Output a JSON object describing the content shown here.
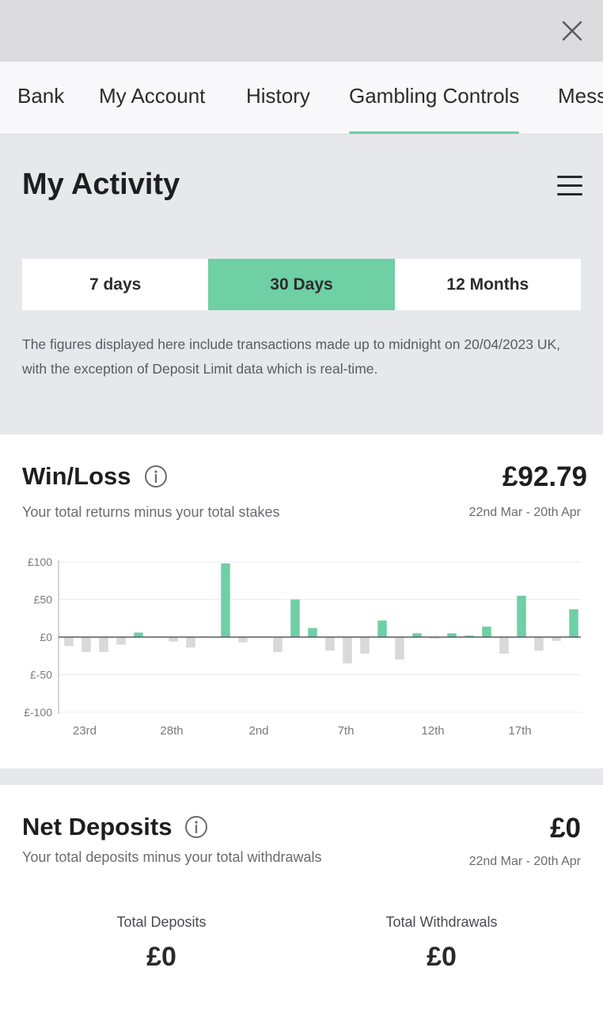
{
  "header": {
    "tabs": [
      {
        "label": "Bank"
      },
      {
        "label": "My Account"
      },
      {
        "label": "History"
      },
      {
        "label": "Gambling Controls"
      },
      {
        "label": "Mess"
      }
    ],
    "active_tab": "Gambling Controls",
    "close_icon": "close-icon"
  },
  "page": {
    "title": "My Activity",
    "menu_icon": "hamburger-menu-icon"
  },
  "period_selector": {
    "options": [
      {
        "label": "7 days"
      },
      {
        "label": "30 Days"
      },
      {
        "label": "12 Months"
      }
    ],
    "selected": "30 Days"
  },
  "disclaimer": "The figures displayed here include transactions made up to midnight on 20/04/2023 UK, with the exception of Deposit Limit data which is real-time.",
  "win_loss": {
    "title": "Win/Loss",
    "amount": "£92.79",
    "subtitle": "Your total returns minus your total stakes",
    "date_range": "22nd Mar - 20th Apr"
  },
  "net_deposits": {
    "title": "Net Deposits",
    "amount": "£0",
    "subtitle": "Your total deposits minus your total withdrawals",
    "date_range": "22nd Mar - 20th Apr",
    "total_deposits_label": "Total Deposits",
    "total_deposits_value": "£0",
    "total_withdrawals_label": "Total Withdrawals",
    "total_withdrawals_value": "£0"
  },
  "colors": {
    "accent": "#6fcfa5",
    "loss_bar": "#d9d9dc",
    "text_dark": "#1e1e20"
  },
  "chart_data": {
    "type": "bar",
    "ylim": [
      -100,
      100
    ],
    "yticks": [
      "£100",
      "£50",
      "£0",
      "£-50",
      "£-100"
    ],
    "ytick_values": [
      100,
      50,
      0,
      -50,
      -100
    ],
    "xtick_labels": [
      "23rd",
      "28th",
      "2nd",
      "7th",
      "12th",
      "17th"
    ],
    "xtick_day_index": [
      1,
      6,
      11,
      16,
      21,
      26
    ],
    "categories": [
      "22 Mar",
      "23 Mar",
      "24 Mar",
      "25 Mar",
      "26 Mar",
      "27 Mar",
      "28 Mar",
      "29 Mar",
      "30 Mar",
      "31 Mar",
      "1 Apr",
      "2 Apr",
      "3 Apr",
      "4 Apr",
      "5 Apr",
      "6 Apr",
      "7 Apr",
      "8 Apr",
      "9 Apr",
      "10 Apr",
      "11 Apr",
      "12 Apr",
      "13 Apr",
      "14 Apr",
      "15 Apr",
      "16 Apr",
      "17 Apr",
      "18 Apr",
      "19 Apr",
      "20 Apr"
    ],
    "values": [
      -12,
      -20,
      -20,
      -10,
      6,
      0,
      -6,
      -14,
      0,
      98,
      -7,
      0,
      -20,
      50,
      12,
      -18,
      -35,
      -22,
      22,
      -30,
      5,
      -2,
      5,
      2,
      14,
      -22,
      55,
      -18,
      -5,
      37
    ],
    "xlabel": "",
    "ylabel": "",
    "grid": true
  }
}
